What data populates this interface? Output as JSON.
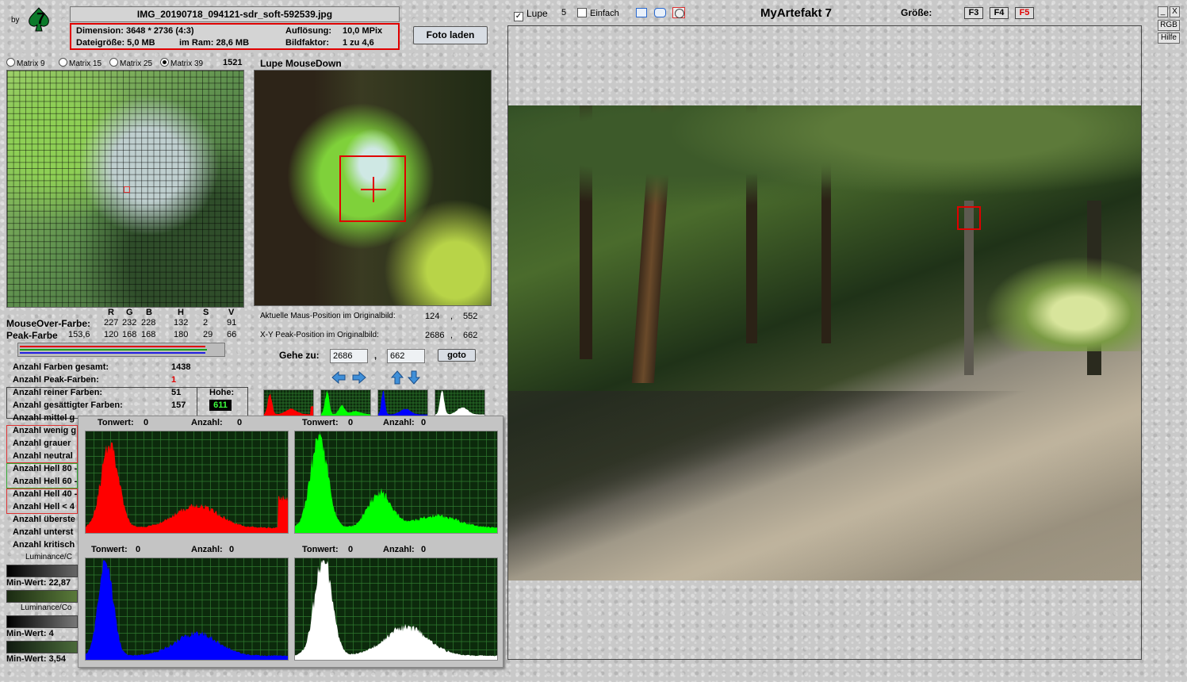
{
  "logo": {
    "by": "by",
    "glyph": "7"
  },
  "file": {
    "name": "IMG_20190718_094121-sdr_soft-592539.jpg",
    "dimension": "Dimension: 3648 * 2736 (4:3)",
    "size": "Dateigröße: 5,0 MB",
    "ram": "im Ram: 28,6 MB",
    "resolution_label": "Auflösung:",
    "resolution_value": "10,0 MPix",
    "factor_label": "Bildfaktor:",
    "factor_value": "1 zu 4,6"
  },
  "load_button": "Foto laden",
  "matrix": {
    "options": [
      "Matrix 9",
      "Matrix 15",
      "Matrix 25",
      "Matrix 39"
    ],
    "selected": "Matrix 39",
    "count": "1521"
  },
  "lupe_title": "Lupe MouseDown",
  "colors": {
    "headers": [
      "R",
      "G",
      "B",
      "H",
      "S",
      "V"
    ],
    "mouseover_label": "MouseOver-Farbe:",
    "mouseover_values": [
      "227",
      "232",
      "228",
      "132",
      "2",
      "91"
    ],
    "peak_label": "Peak-Farbe",
    "peak_extra": "153,6",
    "peak_values": [
      "120",
      "168",
      "168",
      "180",
      "29",
      "66"
    ]
  },
  "positions": {
    "current_label": "Aktuelle Maus-Position  im Originalbild:",
    "current_x": "124",
    "current_y": "552",
    "peak_label": "X-Y Peak-Position  im Originalbild:",
    "peak_x": "2686",
    "peak_y": "662",
    "sep": ","
  },
  "goto": {
    "label": "Gehe zu:",
    "x": "2686",
    "y": "662",
    "button": "goto",
    "sep": ","
  },
  "stats": {
    "total_label": "Anzahl Farben gesamt:",
    "total_value": "1438",
    "peak_label": "Anzahl Peak-Farben:",
    "peak_value": "1",
    "pure_label": "Anzahl reiner Farben:",
    "pure_value": "51",
    "saturated_label": "Anzahl gesättigter Farben:",
    "saturated_value": "157",
    "height_label": "Hohe:",
    "height_value": "611",
    "row_mittel": "Anzahl mittel g",
    "row_wenig": "Anzahl wenig g",
    "row_grauer": "Anzahl grauer",
    "row_neutral": "Anzahl neutral",
    "row_hell80": "Anzahl Hell 80 -",
    "row_hell60": "Anzahl Hell 60 -",
    "row_hell40": "Anzahl Hell 40 -",
    "row_hell_lt": "Anzahl Hell < 4",
    "row_ueber": "Anzahl überste",
    "row_unter": "Anzahl unterst",
    "row_krit": "Anzahl kritisch",
    "lum1_label": "Luminance/C",
    "min1": "Min-Wert: 22,87",
    "lum2_label": "Luminance/Co",
    "min2": "Min-Wert: 4",
    "min3": "Min-Wert: 3,54"
  },
  "histograms": {
    "tonwert": "Tonwert:",
    "anzahl": "Anzahl:",
    "panels": [
      {
        "channel": "red",
        "color": "#ff0000",
        "tonwert": "0",
        "anzahl": "0"
      },
      {
        "channel": "green",
        "color": "#00ff00",
        "tonwert": "0",
        "anzahl": "0"
      },
      {
        "channel": "blue",
        "color": "#0000ff",
        "tonwert": "0",
        "anzahl": "0"
      },
      {
        "channel": "white",
        "color": "#ffffff",
        "tonwert": "0",
        "anzahl": "0"
      }
    ]
  },
  "top": {
    "lupe_label": "Lupe",
    "lupe_value": "5",
    "einfach_label": "Einfach",
    "app_title": "MyArtefakt 7",
    "size_label": "Größe:",
    "size_buttons": [
      "F3",
      "F4",
      "F5"
    ]
  },
  "window": {
    "minimize": "_",
    "close": "X",
    "rgb": "RGB",
    "help": "Hilfe"
  }
}
